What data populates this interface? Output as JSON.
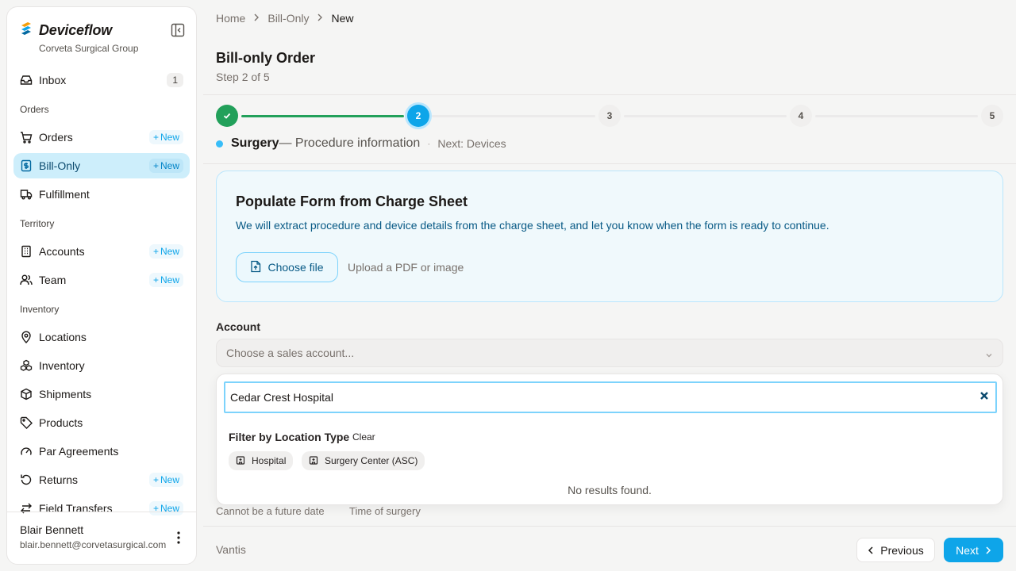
{
  "brand": {
    "name": "Deviceflow",
    "org": "Corveta Surgical Group"
  },
  "sidebar": {
    "inbox": {
      "label": "Inbox",
      "count": "1"
    },
    "sections": {
      "orders": "Orders",
      "territory": "Territory",
      "inventory": "Inventory"
    },
    "items": {
      "orders": {
        "label": "Orders",
        "new": "New"
      },
      "bill_only": {
        "label": "Bill-Only",
        "new": "New"
      },
      "fulfillment": {
        "label": "Fulfillment"
      },
      "accounts": {
        "label": "Accounts",
        "new": "New"
      },
      "team": {
        "label": "Team",
        "new": "New"
      },
      "locations": {
        "label": "Locations"
      },
      "inventory": {
        "label": "Inventory"
      },
      "shipments": {
        "label": "Shipments"
      },
      "products": {
        "label": "Products"
      },
      "par_agreements": {
        "label": "Par Agreements"
      },
      "returns": {
        "label": "Returns",
        "new": "New"
      },
      "field_transfers": {
        "label": "Field Transfers",
        "new": "New"
      }
    },
    "user": {
      "name": "Blair Bennett",
      "email": "blair.bennett@corvetasurgical.com"
    }
  },
  "breadcrumb": [
    "Home",
    "Bill-Only",
    "New"
  ],
  "page": {
    "title": "Bill-only Order",
    "step_text": "Step 2 of 5"
  },
  "stepper": {
    "steps": [
      "",
      "2",
      "3",
      "4",
      "5"
    ],
    "current_step": 2,
    "current_name": "Surgery",
    "current_desc": "— Procedure information",
    "separator": "·",
    "next": "Next: Devices"
  },
  "charge_sheet": {
    "title": "Populate Form from Charge Sheet",
    "description": "We will extract procedure and device details from the charge sheet, and let you know when the form is ready to continue.",
    "button": "Choose file",
    "hint": "Upload a PDF or image"
  },
  "account": {
    "label": "Account",
    "placeholder": "Choose a sales account...",
    "search_value": "Cedar Crest Hospital",
    "filter_title": "Filter by Location Type",
    "clear": "Clear",
    "chips": [
      "Hospital",
      "Surgery Center (ASC)"
    ],
    "no_results": "No results found."
  },
  "field_hints": {
    "date": "Cannot be a future date",
    "time": "Time of surgery"
  },
  "footer": {
    "brand": "Vantis",
    "previous": "Previous",
    "next": "Next"
  },
  "colors": {
    "accent": "#0ea5e9",
    "success": "#22a05a",
    "active_nav": "#cdeefb"
  }
}
